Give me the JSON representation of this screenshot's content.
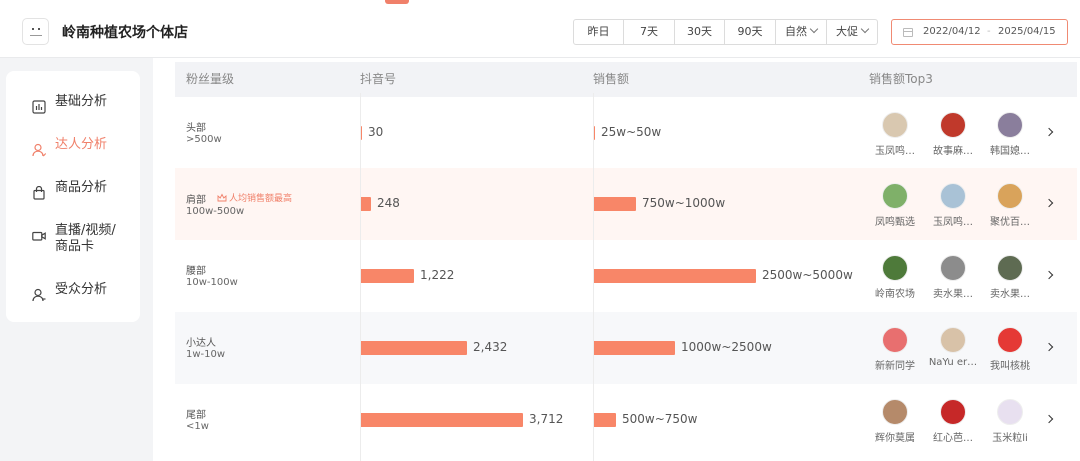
{
  "shop": {
    "name": "岭南种植农场个体店",
    "logo_icon": "shop-logo-icon"
  },
  "filters": [
    {
      "label": "昨日"
    },
    {
      "label": "7天"
    },
    {
      "label": "30天"
    },
    {
      "label": "90天"
    },
    {
      "label": "自然",
      "dropdown": true
    },
    {
      "label": "大促",
      "dropdown": true
    }
  ],
  "date_range": {
    "start": "2022/04/12",
    "separator": "-",
    "end": "2025/04/15",
    "icon": "calendar-icon"
  },
  "sidebar": {
    "items": [
      {
        "label": "基础分析",
        "icon": "bar-chart-icon",
        "active": false
      },
      {
        "label": "达人分析",
        "icon": "user-icon",
        "active": true
      },
      {
        "label": "商品分析",
        "icon": "shopping-bag-icon",
        "active": false
      },
      {
        "label": "直播/视频/\n商品卡",
        "line1": "直播/视频/",
        "line2": "商品卡",
        "icon": "video-camera-icon",
        "active": false
      },
      {
        "label": "受众分析",
        "icon": "audience-icon",
        "active": false
      }
    ]
  },
  "table": {
    "headers": {
      "tier": "粉丝量级",
      "accounts": "抖音号",
      "sales": "销售额",
      "top3": "销售额Top3"
    },
    "accounts_max": 3712,
    "rows": [
      {
        "tier": "头部",
        "range": ">500w",
        "accounts": "30",
        "accounts_value": 30,
        "sales": "25w~50w",
        "sales_level": 0.012,
        "top3": [
          {
            "name": "玉凤鸣…"
          },
          {
            "name": "故事麻…"
          },
          {
            "name": "韩国媳…"
          }
        ]
      },
      {
        "tier": "肩部",
        "range": "100w-500w",
        "badge": "人均销售额最高",
        "accounts": "248",
        "accounts_value": 248,
        "sales": "750w~1000w",
        "sales_level": 0.265,
        "top3": [
          {
            "name": "凤鸣甄选"
          },
          {
            "name": "玉凤鸣…"
          },
          {
            "name": "聚优百…"
          }
        ]
      },
      {
        "tier": "腰部",
        "range": "10w-100w",
        "accounts": "1,222",
        "accounts_value": 1222,
        "sales": "2500w~5000w",
        "sales_level": 1.0,
        "top3": [
          {
            "name": "岭南农场"
          },
          {
            "name": "卖水果…"
          },
          {
            "name": "卖水果…"
          }
        ]
      },
      {
        "tier": "小达人",
        "range": "1w-10w",
        "accounts": "2,432",
        "accounts_value": 2432,
        "sales": "1000w~2500w",
        "sales_level": 0.5,
        "top3": [
          {
            "name": "新新同学"
          },
          {
            "name": "NaYu er…"
          },
          {
            "name": "我叫核桃"
          }
        ]
      },
      {
        "tier": "尾部",
        "range": "<1w",
        "accounts": "3,712",
        "accounts_value": 3712,
        "sales": "500w~750w",
        "sales_level": 0.144,
        "top3": [
          {
            "name": "辉你莫属"
          },
          {
            "name": "红心芭…"
          },
          {
            "name": "玉米粒li"
          }
        ]
      }
    ]
  },
  "colors": {
    "accent": "#f0806a",
    "bar": "#f88668",
    "highlight_row": "#fff6f3"
  }
}
